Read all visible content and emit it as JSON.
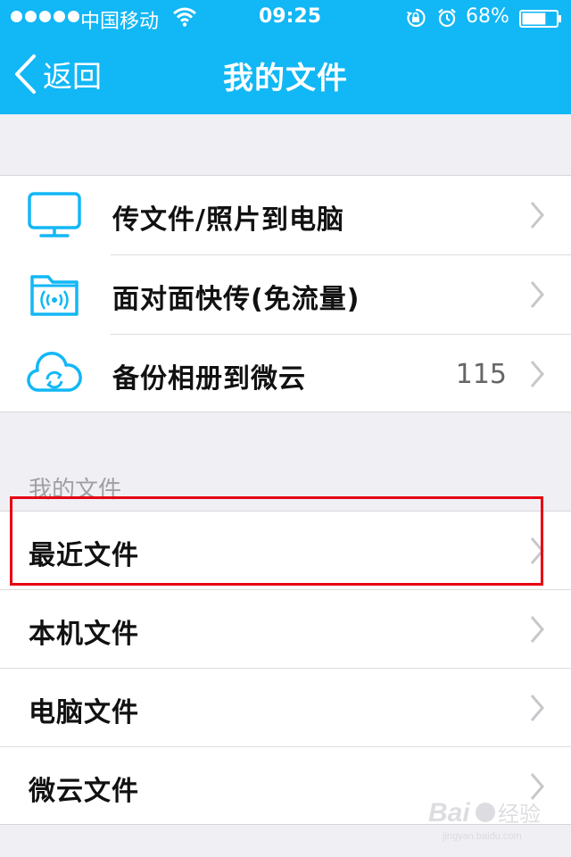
{
  "status_bar": {
    "carrier": "中国移动",
    "time": "09:25",
    "battery": "68%",
    "battery_level": 0.68,
    "icons": [
      "signal-dots-icon",
      "wifi-icon",
      "rotation-lock-icon",
      "alarm-icon",
      "battery-icon"
    ]
  },
  "nav": {
    "back_label": "返回",
    "title": "我的文件"
  },
  "transfer_section": {
    "items": [
      {
        "label": "传文件/照片到电脑",
        "icon": "monitor-icon",
        "count": ""
      },
      {
        "label": "面对面快传(免流量)",
        "icon": "wireless-folder-icon",
        "count": ""
      },
      {
        "label": "备份相册到微云",
        "icon": "cloud-sync-icon",
        "count": "115"
      }
    ]
  },
  "files_section": {
    "header": "我的文件",
    "items": [
      {
        "label": "最近文件"
      },
      {
        "label": "本机文件"
      },
      {
        "label": "电脑文件"
      },
      {
        "label": "微云文件"
      }
    ]
  },
  "colors": {
    "header_bg": "#12b7f5",
    "accent": "#12b7f5",
    "highlight": "#e60012"
  }
}
